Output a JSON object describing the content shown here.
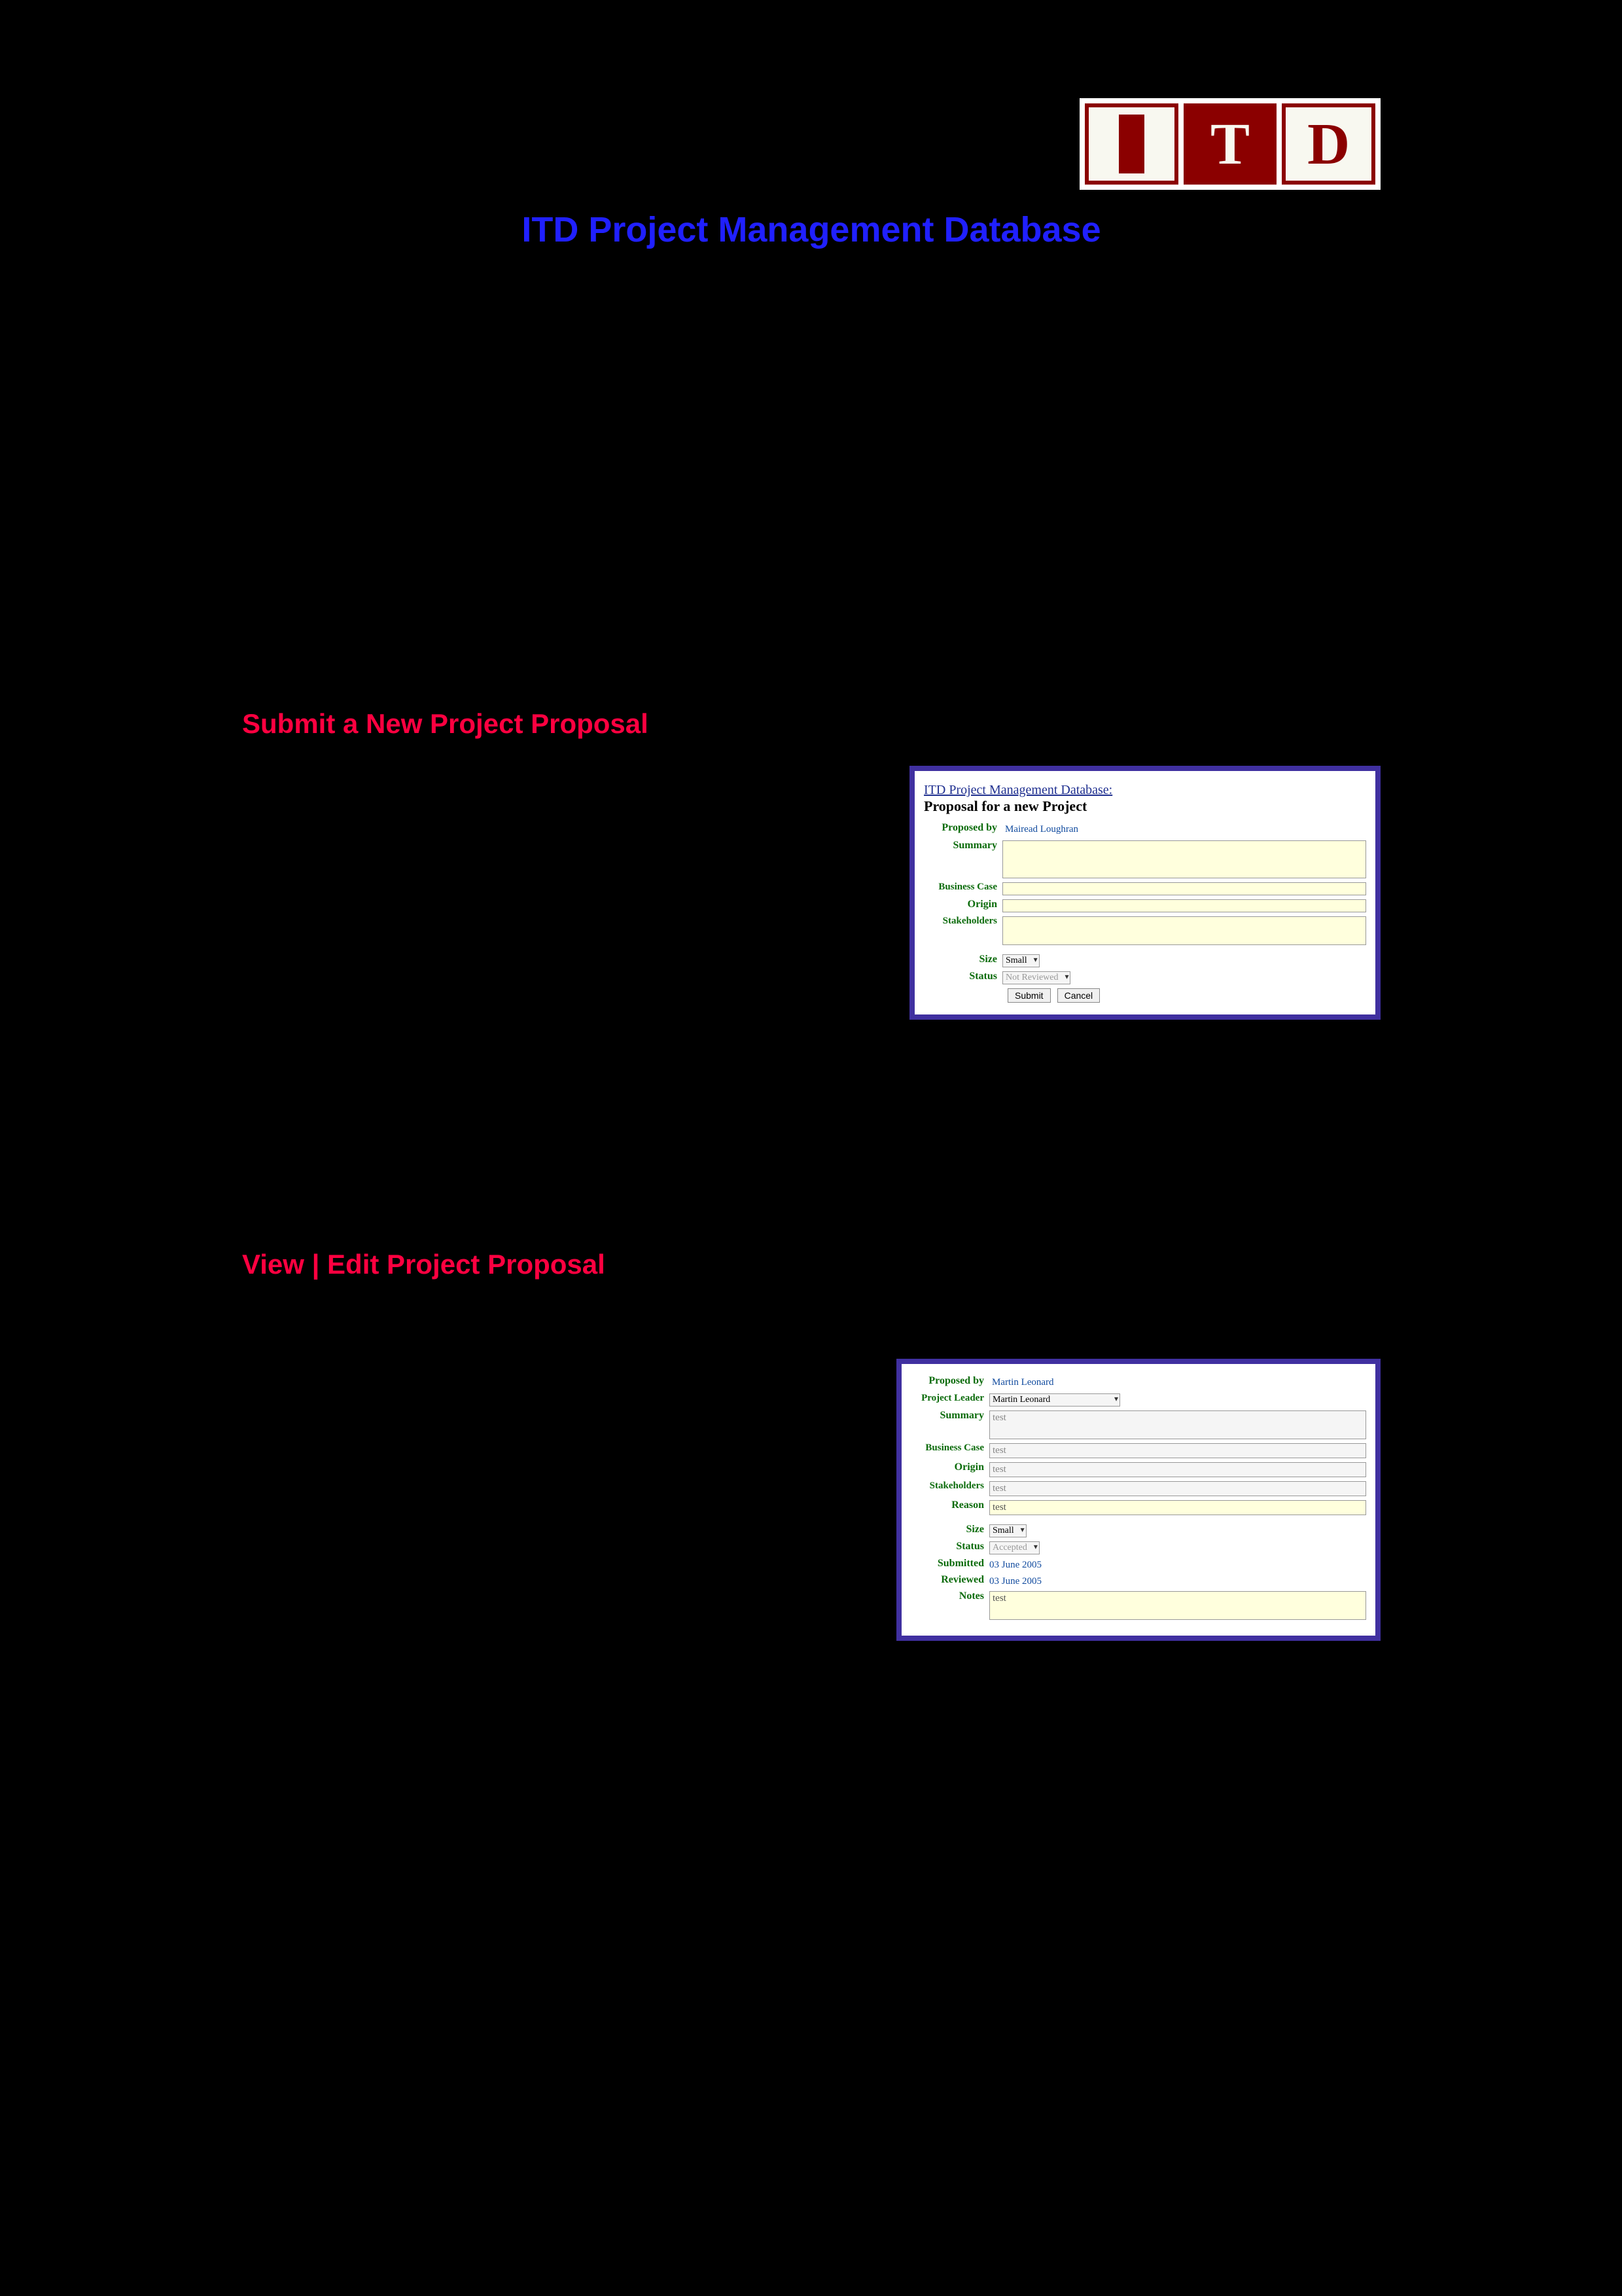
{
  "header": {
    "main_title": "ITD Project Management Database"
  },
  "section_submit": {
    "title": "Submit a New Project Proposal"
  },
  "section_view": {
    "title": "View | Edit Project Proposal"
  },
  "form1": {
    "breadcrumb": "ITD Project Management Database:",
    "heading": "Proposal for a new Project",
    "proposed_by_label": "Proposed by",
    "proposed_by_value": "Mairead Loughran",
    "summary_label": "Summary",
    "business_case_label": "Business Case",
    "origin_label": "Origin",
    "stakeholders_label": "Stakeholders",
    "size_label": "Size",
    "size_value": "Small",
    "status_label": "Status",
    "status_value": "Not Reviewed",
    "submit_btn": "Submit",
    "cancel_btn": "Cancel"
  },
  "form2": {
    "proposed_by_label": "Proposed by",
    "proposed_by_value": "Martin Leonard",
    "project_leader_label": "Project Leader",
    "project_leader_value": "Martin Leonard",
    "summary_label": "Summary",
    "summary_value": "test",
    "business_case_label": "Business Case",
    "business_case_value": "test",
    "origin_label": "Origin",
    "origin_value": "test",
    "stakeholders_label": "Stakeholders",
    "stakeholders_value": "test",
    "reason_label": "Reason",
    "reason_value": "test",
    "size_label": "Size",
    "size_value": "Small",
    "status_label": "Status",
    "status_value": "Accepted",
    "submitted_label": "Submitted",
    "submitted_value": "03 June 2005",
    "reviewed_label": "Reviewed",
    "reviewed_value": "03 June 2005",
    "notes_label": "Notes",
    "notes_value": "test"
  }
}
